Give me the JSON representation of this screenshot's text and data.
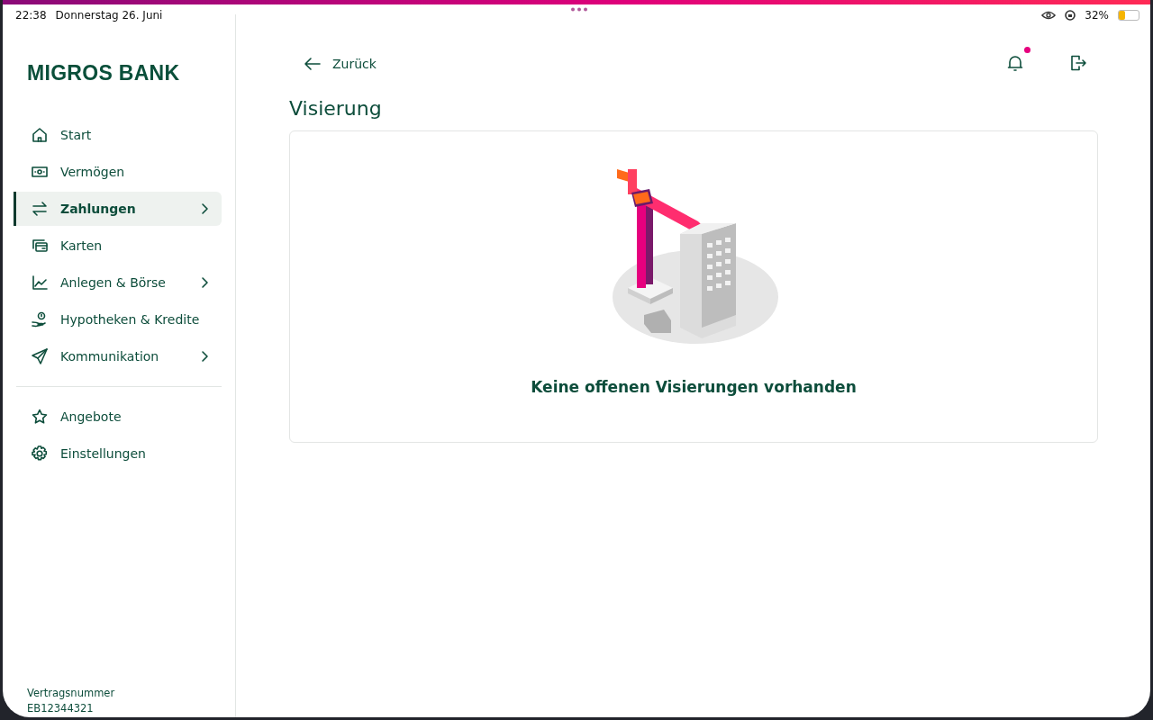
{
  "status_bar": {
    "time": "22:38",
    "date": "Donnerstag 26. Juni",
    "battery": "32%"
  },
  "sidebar": {
    "logo": "MIGROS BANK",
    "groups": [
      [
        {
          "label": "Start",
          "selected": false,
          "has_submenu": false
        },
        {
          "label": "Vermögen",
          "selected": false,
          "has_submenu": false
        },
        {
          "label": "Zahlungen",
          "selected": true,
          "has_submenu": true
        },
        {
          "label": "Karten",
          "selected": false,
          "has_submenu": false
        },
        {
          "label": "Anlegen & Börse",
          "selected": false,
          "has_submenu": true
        },
        {
          "label": "Hypotheken & Kredite",
          "selected": false,
          "has_submenu": false
        },
        {
          "label": "Kommunikation",
          "selected": false,
          "has_submenu": true
        }
      ],
      [
        {
          "label": "Angebote",
          "selected": false,
          "has_submenu": false
        },
        {
          "label": "Einstellungen",
          "selected": false,
          "has_submenu": false
        }
      ]
    ],
    "contract": {
      "label": "Vertragsnummer",
      "number": "EB12344321"
    }
  },
  "header": {
    "back": "Zurück",
    "notifications_unread": true
  },
  "page": {
    "title": "Visierung",
    "empty_message": "Keine offenen Visierungen vorhanden"
  }
}
